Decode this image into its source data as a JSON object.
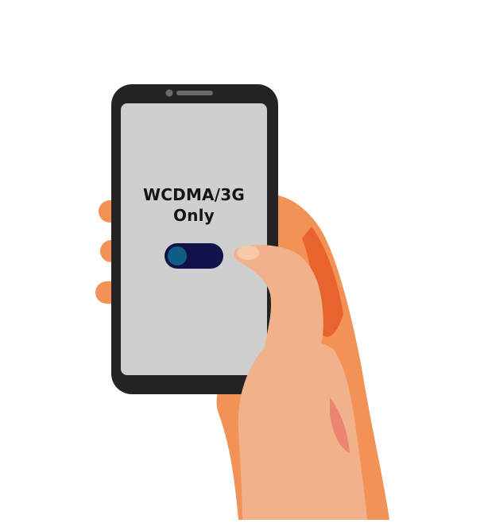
{
  "screen": {
    "title_line1": "WCDMA/3G",
    "title_line2": "Only"
  },
  "toggle": {
    "state": "off"
  },
  "colors": {
    "phone_body": "#232323",
    "screen": "#cfcfcf",
    "skin_light": "#f1b28b",
    "skin_mid": "#f39257",
    "skin_dark": "#e9642d",
    "toggle_track": "#12124a",
    "toggle_knob": "#0f5e86"
  },
  "icons": [
    "front-camera-icon",
    "speaker-grille-icon"
  ]
}
